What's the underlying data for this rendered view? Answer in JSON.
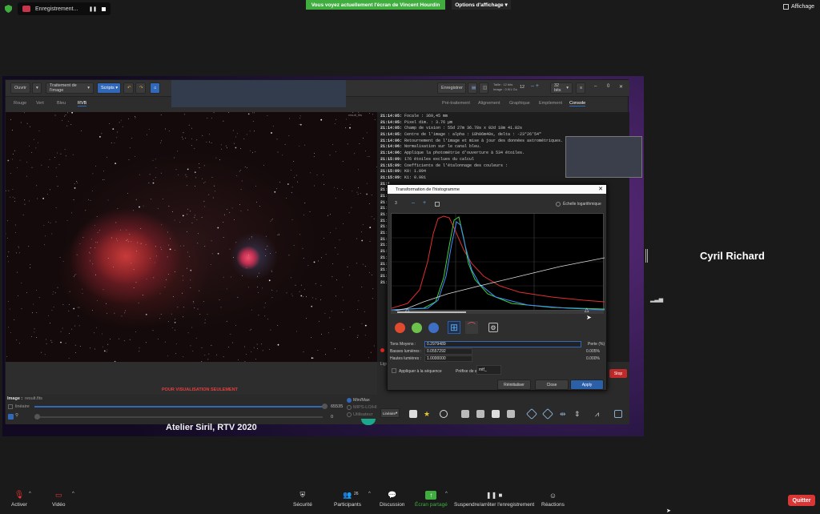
{
  "zoom": {
    "recording_label": "Enregistrement...",
    "share_banner": "Vous voyez actuellement l'écran de Vincent Hourdin",
    "view_options": "Options d'affichage",
    "view_options_chevron": "▾",
    "affichage": "Affichage",
    "speaker_name": "Cyril Richard",
    "quit_label": "Quitter",
    "participants_count": "26",
    "bottom": {
      "audio": "Activer",
      "video": "Vidéo",
      "security": "Sécurité",
      "participants": "Participants",
      "chat": "Discussion",
      "share": "Écran partagé",
      "pause_rec": "Suspendre/arrêter l'enregistrement",
      "reactions": "Réactions"
    },
    "accent_share": "#3fae3f",
    "accent_quit": "#d93636"
  },
  "siril": {
    "toolbar": {
      "open": "Ouvrir",
      "image_processing": "Traitement de l'image",
      "scripts": "Scripts",
      "save": "Enregistrer",
      "size": "Taille : 12 bits",
      "image_size": "Image : 0.9/1 Go",
      "threads": "12",
      "bits": "32 bits",
      "minimize": "–",
      "count": "0",
      "close": "✕"
    },
    "tabs_left": [
      "Rouge",
      "Vert",
      "Bleu",
      "RVB"
    ],
    "tabs_right": [
      "Pré-traitement",
      "Alignement",
      "Graphique",
      "Empilement",
      "Console"
    ],
    "filename": "result_fits",
    "vis_only": "POUR VISUALISATION SEULEMENT",
    "bottom": {
      "image_label": "Image :",
      "image_name": "result.fits",
      "linear_label": "linéaire",
      "slider_max": "65535",
      "slider_min": "0",
      "minmax": "Min/Max",
      "mips": "MIPS-LO/HI",
      "user": "Utilisateur",
      "stretch": "Linéaire"
    },
    "console_lines": [
      {
        "time": "21:14:05:",
        "text": "Focale :          369,45 mm"
      },
      {
        "time": "21:14:05:",
        "text": "Pixel dim. :        3.76 µm"
      },
      {
        "time": "21:14:05:",
        "text": "Champ de vision :   55d 27m 36.78s x 02d 18m 41.82s"
      },
      {
        "time": "21:14:05:",
        "text": "Centre de l'image : alpha :  18h06m40s, delta : -23°26'54\""
      },
      {
        "time": "21:14:06:",
        "text": "Retournement de l'image et mise à jour des données astrométriques."
      },
      {
        "time": "21:14:06:",
        "text": "Normalisation sur le canal bleu."
      },
      {
        "time": "21:14:06:",
        "text": "Applique la photométrie d'ouverture à 534 étoiles."
      },
      {
        "time": "21:15:09:",
        "text": "176 étoiles exclues du calcul"
      },
      {
        "time": "21:15:09:",
        "text": "Coefficients de l'étalonnage des couleurs :"
      },
      {
        "time": "21:15:09:",
        "text": "K0: 1.094"
      },
      {
        "time": "21:15:09:",
        "text": "K1: 0.981"
      }
    ],
    "console_extra_times": [
      "21:1",
      "21:1",
      "21:1",
      "21:1",
      "21:1",
      "21:1",
      "21:1",
      "21:1",
      "21:1",
      "21:1",
      "21:1",
      "21:1",
      "21:1",
      "21:1",
      "21:1",
      "21:1",
      "21:1"
    ],
    "ligne_label": "Ligne c",
    "workshop_banner": "Atelier Siril, RTV 2020",
    "stop_btn": "Stop"
  },
  "histogram": {
    "title": "Transformation de l'histogramme",
    "zoom_value": "3",
    "minus": "–",
    "plus": "+",
    "log_scale": "Échelle logarithmique",
    "midtones_label": "Tons Moyens :",
    "midtones_value": "0.2979489",
    "shadows_label": "Basses lumières :",
    "shadows_value": "0.0557292",
    "highlights_label": "Hautes lumières :",
    "highlights_value": "1.0000000",
    "loss_label": "Perte (%)",
    "loss_shadows": "0.005%",
    "loss_highlights": "0.000%",
    "apply_seq": "Appliquer à la séquence",
    "prefix_label": "Préfixe de sortie :",
    "prefix_value": "mtf_",
    "reset": "Réinitialiser",
    "close": "Close",
    "apply": "Apply",
    "colors": {
      "red": "#e04a2e",
      "green": "#6cc24a",
      "blue": "#3d6fc4"
    }
  }
}
